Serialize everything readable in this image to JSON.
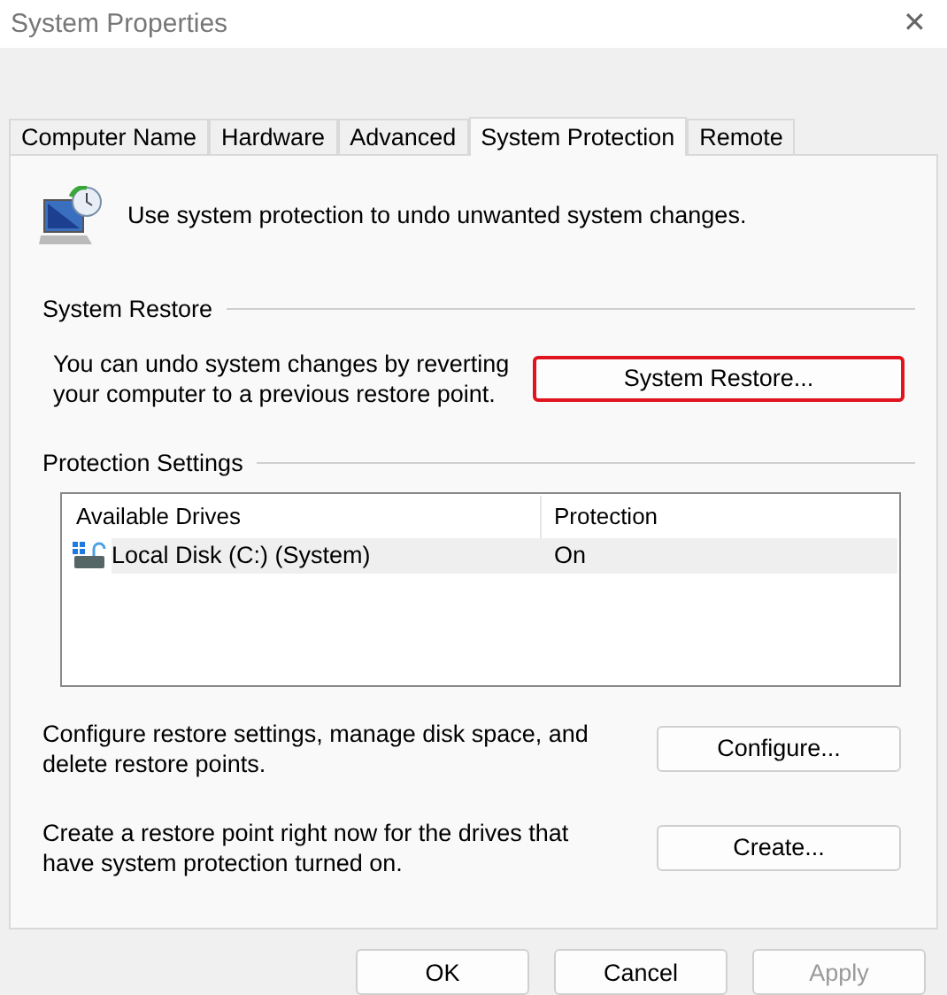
{
  "window": {
    "title": "System Properties",
    "close": "✕"
  },
  "tabs": [
    {
      "label": "Computer Name",
      "selected": false
    },
    {
      "label": "Hardware",
      "selected": false
    },
    {
      "label": "Advanced",
      "selected": false
    },
    {
      "label": "System Protection",
      "selected": true
    },
    {
      "label": "Remote",
      "selected": false
    }
  ],
  "intro": "Use system protection to undo unwanted system changes.",
  "system_restore": {
    "heading": "System Restore",
    "text": "You can undo system changes by reverting your computer to a previous restore point.",
    "button": {
      "label": "System Restore...",
      "highlighted": true
    }
  },
  "protection_settings": {
    "heading": "Protection Settings",
    "columns": [
      "Available Drives",
      "Protection"
    ],
    "rows": [
      {
        "drive": "Local Disk (C:) (System)",
        "protection": "On",
        "selected": true
      }
    ]
  },
  "actions": [
    {
      "text": "Configure restore settings, manage disk space, and delete restore points.",
      "button": "Configure..."
    },
    {
      "text": "Create a restore point right now for the drives that have system protection turned on.",
      "button": "Create..."
    }
  ],
  "buttons": [
    {
      "label": "OK",
      "disabled": false
    },
    {
      "label": "Cancel",
      "disabled": false
    },
    {
      "label": "Apply",
      "disabled": true
    }
  ]
}
